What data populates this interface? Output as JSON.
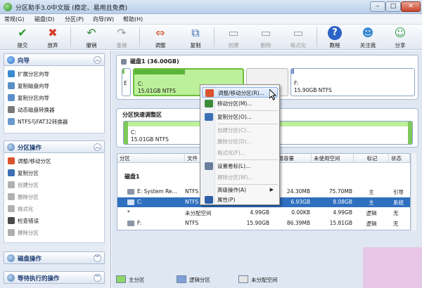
{
  "window": {
    "title": "分区助手3.0中文版 (稳定、易用且免费)",
    "min": "–",
    "max": "□",
    "close": "✕"
  },
  "menu": [
    "常规(G)",
    "磁盘(D)",
    "分区(P)",
    "向导(W)",
    "帮助(H)"
  ],
  "toolbar": [
    {
      "label": "提交",
      "icon": "check-icon",
      "glyph": "✔",
      "color": "#2f9e2f",
      "disabled": false
    },
    {
      "label": "放弃",
      "icon": "cross-icon",
      "glyph": "✖",
      "color": "#d93a2b",
      "disabled": false
    },
    {
      "label": "撤销",
      "icon": "undo-icon",
      "glyph": "↶",
      "color": "#3a8a3a",
      "disabled": false
    },
    {
      "label": "重做",
      "icon": "redo-icon",
      "glyph": "↷",
      "color": "#9a9a9a",
      "disabled": true
    },
    {
      "label": "调整",
      "icon": "resize-icon",
      "glyph": "⇔",
      "color": "#d9532b",
      "disabled": false
    },
    {
      "label": "复制",
      "icon": "copy-disk-icon",
      "glyph": "⧉",
      "color": "#3b6fb5",
      "disabled": false
    },
    {
      "label": "创建",
      "icon": "create-icon",
      "glyph": "▭",
      "color": "#9a9a9a",
      "disabled": true
    },
    {
      "label": "删除",
      "icon": "delete-icon",
      "glyph": "▭",
      "color": "#9a9a9a",
      "disabled": true
    },
    {
      "label": "格式化",
      "icon": "format-icon",
      "glyph": "▭",
      "color": "#9a9a9a",
      "disabled": true
    },
    {
      "label": "教程",
      "icon": "help-icon",
      "glyph": "?",
      "color": "#2c63c7",
      "disabled": false
    },
    {
      "label": "关注我",
      "icon": "follow-icon",
      "glyph": "☻",
      "color": "#3a8ad0",
      "disabled": false
    },
    {
      "label": "分享",
      "icon": "share-icon",
      "glyph": "☺",
      "color": "#3aa04a",
      "disabled": false
    }
  ],
  "left": {
    "wizard": {
      "title": "向导",
      "items": [
        {
          "label": "扩展分区向导",
          "disabled": false
        },
        {
          "label": "复制磁盘向导",
          "disabled": false
        },
        {
          "label": "复制分区向导",
          "disabled": false
        },
        {
          "label": "动态磁盘转换器",
          "disabled": false
        },
        {
          "label": "NTFS与FAT32转换器",
          "disabled": false
        }
      ]
    },
    "partition_ops": {
      "title": "分区操作",
      "items": [
        {
          "label": "调整/移动分区",
          "disabled": false
        },
        {
          "label": "复制分区",
          "disabled": false
        },
        {
          "label": "创建分区",
          "disabled": true
        },
        {
          "label": "删除分区",
          "disabled": true
        },
        {
          "label": "格式化",
          "disabled": true
        },
        {
          "label": "检查错误",
          "disabled": false
        },
        {
          "label": "擦除分区",
          "disabled": true
        }
      ]
    },
    "disk_ops": {
      "title": "磁盘操作"
    },
    "pending_ops": {
      "title": "等待执行的操作"
    }
  },
  "disk_map": {
    "title": "磁盘1 (36.00GB)",
    "partitions": [
      {
        "letter": "E",
        "size": "",
        "used": 0.3
      },
      {
        "letter": "C:",
        "size": "15.01GB NTFS",
        "used": 0.47
      },
      {
        "letter": "*",
        "size": "",
        "used": 0
      },
      {
        "letter": "F:",
        "size": "15.90GB NTFS",
        "used": 0.02
      }
    ]
  },
  "fast_adjust": {
    "title": "分区快速调整区",
    "partition": {
      "letter": "C:",
      "size": "15.01GB NTFS"
    }
  },
  "table": {
    "headers": [
      "分区",
      "文件",
      "容量",
      "已用容量",
      "未使用空间",
      "标记",
      "状态"
    ],
    "disk_label": "磁盘1",
    "rows": [
      {
        "partition": "E:  System Re...",
        "fs": "NTFS",
        "capacity": "",
        "used": "24.30MB",
        "free": "75.70MB",
        "flag": "主",
        "status": "引导"
      },
      {
        "partition": "C:",
        "fs": "NTFS",
        "capacity": "",
        "used": "6.93GB",
        "free": "8.08GB",
        "flag": "主",
        "status": "系统"
      },
      {
        "partition": "*",
        "fs": "未分配空间",
        "capacity": "4.99GB",
        "used": "0.00KB",
        "free": "4.99GB",
        "flag": "逻辑",
        "status": "无"
      },
      {
        "partition": "F:",
        "fs": "NTFS",
        "capacity": "15.90GB",
        "used": "86.39MB",
        "free": "15.81GB",
        "flag": "逻辑",
        "status": "无"
      }
    ]
  },
  "legend": [
    {
      "label": "主分区",
      "color": "#8fd66a"
    },
    {
      "label": "逻辑分区",
      "color": "#7f9fd8"
    },
    {
      "label": "未分配空间",
      "color": "#e0e0e0"
    }
  ],
  "context_menu": [
    {
      "label": "调整/移动分区(R)...",
      "icon": "resize-icon",
      "color": "#d9532b",
      "disabled": false,
      "hot": true
    },
    {
      "label": "移动分区(M)...",
      "icon": "move-icon",
      "color": "#3a8a3a",
      "disabled": false
    },
    {
      "label": "复制分区(O)...",
      "icon": "copy-icon",
      "color": "#3b6fb5",
      "disabled": false
    },
    {
      "label": "创建分区(C)...",
      "icon": "create-icon",
      "color": "#b0b0b0",
      "disabled": true
    },
    {
      "label": "删除分区(D)...",
      "icon": "delete-icon",
      "color": "#b0b0b0",
      "disabled": true
    },
    {
      "label": "格式化(F)...",
      "icon": "format-icon",
      "color": "#b0b0b0",
      "disabled": true
    },
    {
      "label": "设置卷标(L)...",
      "icon": "label-icon",
      "color": "#6a7d9b",
      "disabled": false
    },
    {
      "label": "擦除分区(W)...",
      "icon": "wipe-icon",
      "color": "#b0b0b0",
      "disabled": true
    },
    {
      "label": "高级操作(A)",
      "icon": "",
      "color": "",
      "disabled": false,
      "submenu": "▶"
    },
    {
      "label": "属性(P)",
      "icon": "properties-icon",
      "color": "#2e5fa8",
      "disabled": false
    }
  ]
}
